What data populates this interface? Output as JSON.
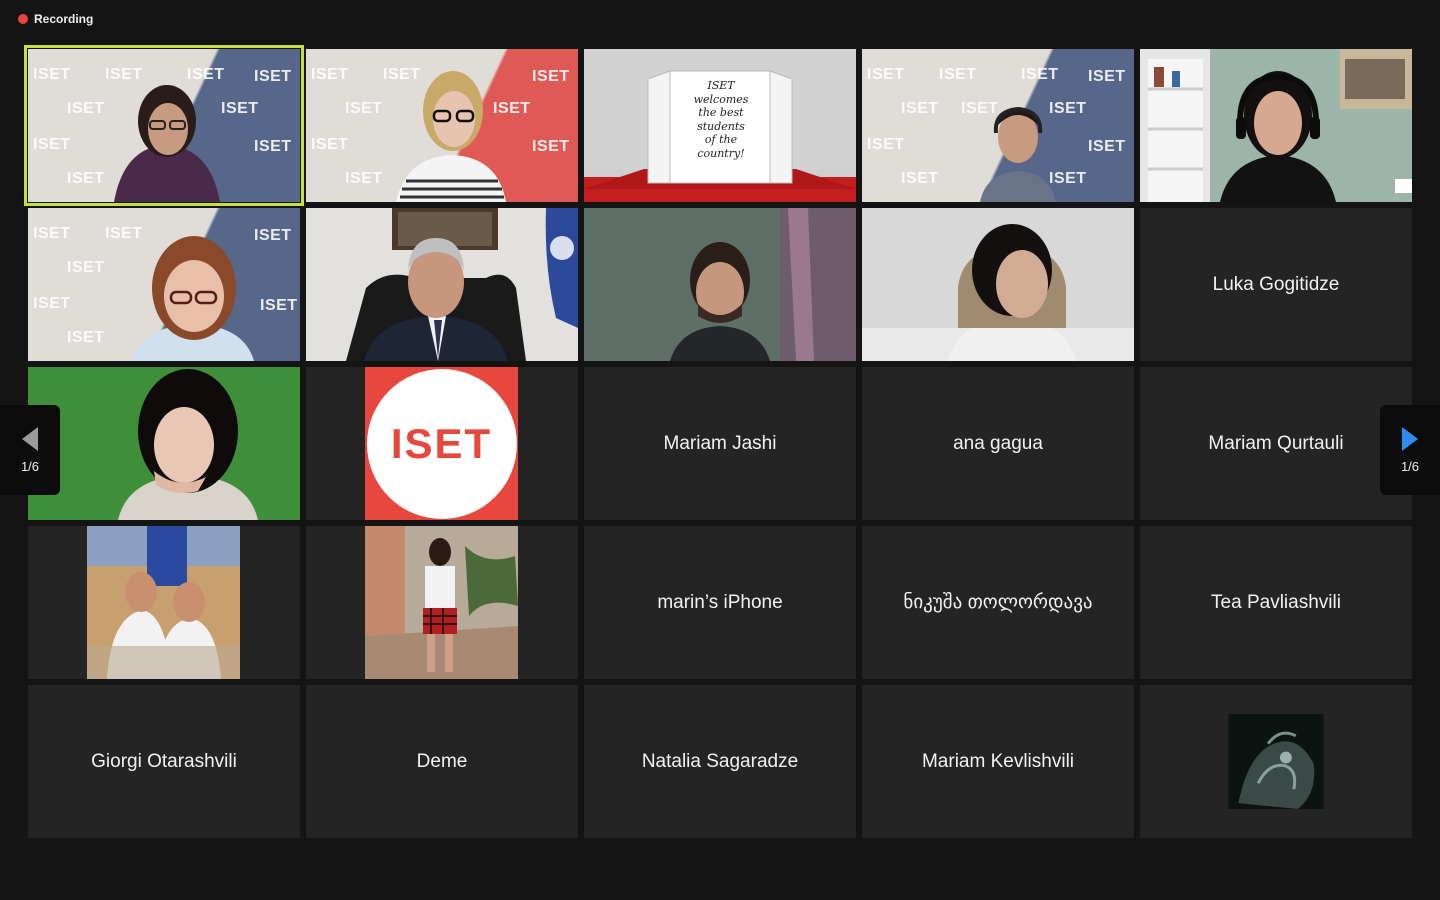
{
  "recording": {
    "label": "Recording",
    "color": "#e8453c"
  },
  "pager": {
    "left_page": "1/6",
    "right_page": "1/6"
  },
  "watermark": "ISET",
  "door_note": [
    "ISET",
    "welcomes",
    "the best",
    "students",
    "of the",
    "country!"
  ],
  "logo_text": "ISET",
  "accent": {
    "active_speaker": "#c8e03c",
    "next_arrow": "#2d8cf0"
  },
  "names": {
    "luka": "Luka Gogitidze",
    "mariam_jashi": "Mariam Jashi",
    "ana": "ana gagua",
    "mariam_qurtauli": "Mariam Qurtauli",
    "marin": "marin’s iPhone",
    "nikusha": "ნიკუშა თოლორდავა",
    "tea": "Tea Pavliashvili",
    "giorgi": "Giorgi Otarashvili",
    "deme": "Deme",
    "natalia": "Natalia Sagaradze",
    "mariam_kevlishvili": "Mariam Kevlishvili"
  }
}
